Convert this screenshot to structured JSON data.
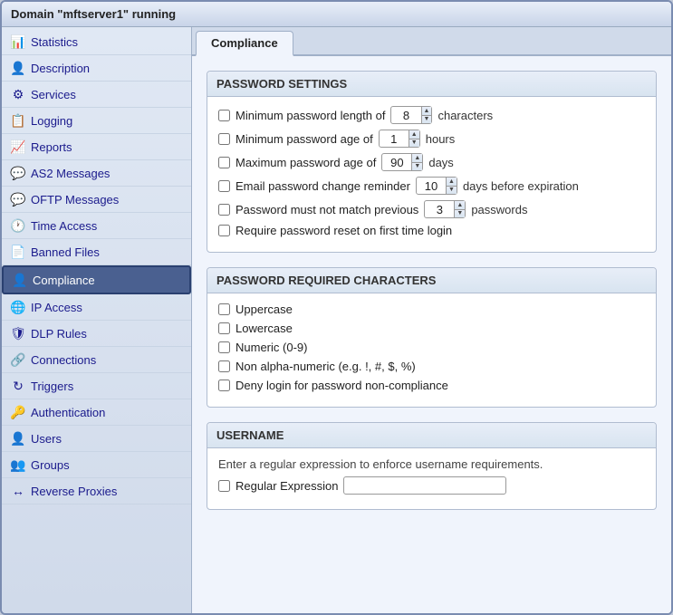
{
  "window": {
    "title": "Domain \"mftserver1\" running"
  },
  "sidebar": {
    "items": [
      {
        "id": "statistics",
        "label": "Statistics",
        "icon": "📊",
        "active": false
      },
      {
        "id": "description",
        "label": "Description",
        "icon": "👤",
        "active": false
      },
      {
        "id": "services",
        "label": "Services",
        "icon": "🔧",
        "active": false
      },
      {
        "id": "logging",
        "label": "Logging",
        "icon": "📋",
        "active": false
      },
      {
        "id": "reports",
        "label": "Reports",
        "icon": "📈",
        "active": false
      },
      {
        "id": "as2-messages",
        "label": "AS2 Messages",
        "icon": "💬",
        "active": false
      },
      {
        "id": "oftp-messages",
        "label": "OFTP Messages",
        "icon": "💬",
        "active": false
      },
      {
        "id": "time-access",
        "label": "Time Access",
        "icon": "⏰",
        "active": false
      },
      {
        "id": "banned-files",
        "label": "Banned Files",
        "icon": "📄",
        "active": false
      },
      {
        "id": "compliance",
        "label": "Compliance",
        "icon": "👤",
        "active": true
      },
      {
        "id": "ip-access",
        "label": "IP Access",
        "icon": "🌐",
        "active": false
      },
      {
        "id": "dlp-rules",
        "label": "DLP Rules",
        "icon": "🛡️",
        "active": false
      },
      {
        "id": "connections",
        "label": "Connections",
        "icon": "🔗",
        "active": false
      },
      {
        "id": "triggers",
        "label": "Triggers",
        "icon": "🔁",
        "active": false
      },
      {
        "id": "authentication",
        "label": "Authentication",
        "icon": "🔑",
        "active": false
      },
      {
        "id": "users",
        "label": "Users",
        "icon": "👤",
        "active": false
      },
      {
        "id": "groups",
        "label": "Groups",
        "icon": "👥",
        "active": false
      },
      {
        "id": "reverse-proxies",
        "label": "Reverse Proxies",
        "icon": "🔄",
        "active": false
      }
    ]
  },
  "tabs": [
    {
      "id": "compliance",
      "label": "Compliance",
      "active": true
    }
  ],
  "password_settings": {
    "section_title": "PASSWORD SETTINGS",
    "fields": [
      {
        "id": "min-length",
        "label": "Minimum password length of",
        "value": "8",
        "unit": "characters"
      },
      {
        "id": "min-age",
        "label": "Minimum password age of",
        "value": "1",
        "unit": "hours"
      },
      {
        "id": "max-age",
        "label": "Maximum password age of",
        "value": "90",
        "unit": "days"
      },
      {
        "id": "email-reminder",
        "label": "Email password change reminder",
        "value": "10",
        "unit": "days before expiration"
      },
      {
        "id": "no-match-prev",
        "label": "Password must not match previous",
        "value": "3",
        "unit": "passwords"
      }
    ],
    "require_reset_label": "Require password reset on first time login"
  },
  "password_required_chars": {
    "section_title": "PASSWORD REQUIRED CHARACTERS",
    "fields": [
      {
        "id": "uppercase",
        "label": "Uppercase"
      },
      {
        "id": "lowercase",
        "label": "Lowercase"
      },
      {
        "id": "numeric",
        "label": "Numeric (0-9)"
      },
      {
        "id": "non-alpha",
        "label": "Non alpha-numeric (e.g. !, #, $, %)"
      },
      {
        "id": "deny-login",
        "label": "Deny login for password non-compliance"
      }
    ]
  },
  "username": {
    "section_title": "USERNAME",
    "description": "Enter a regular expression to enforce username requirements.",
    "regex_label": "Regular Expression",
    "regex_value": ""
  }
}
